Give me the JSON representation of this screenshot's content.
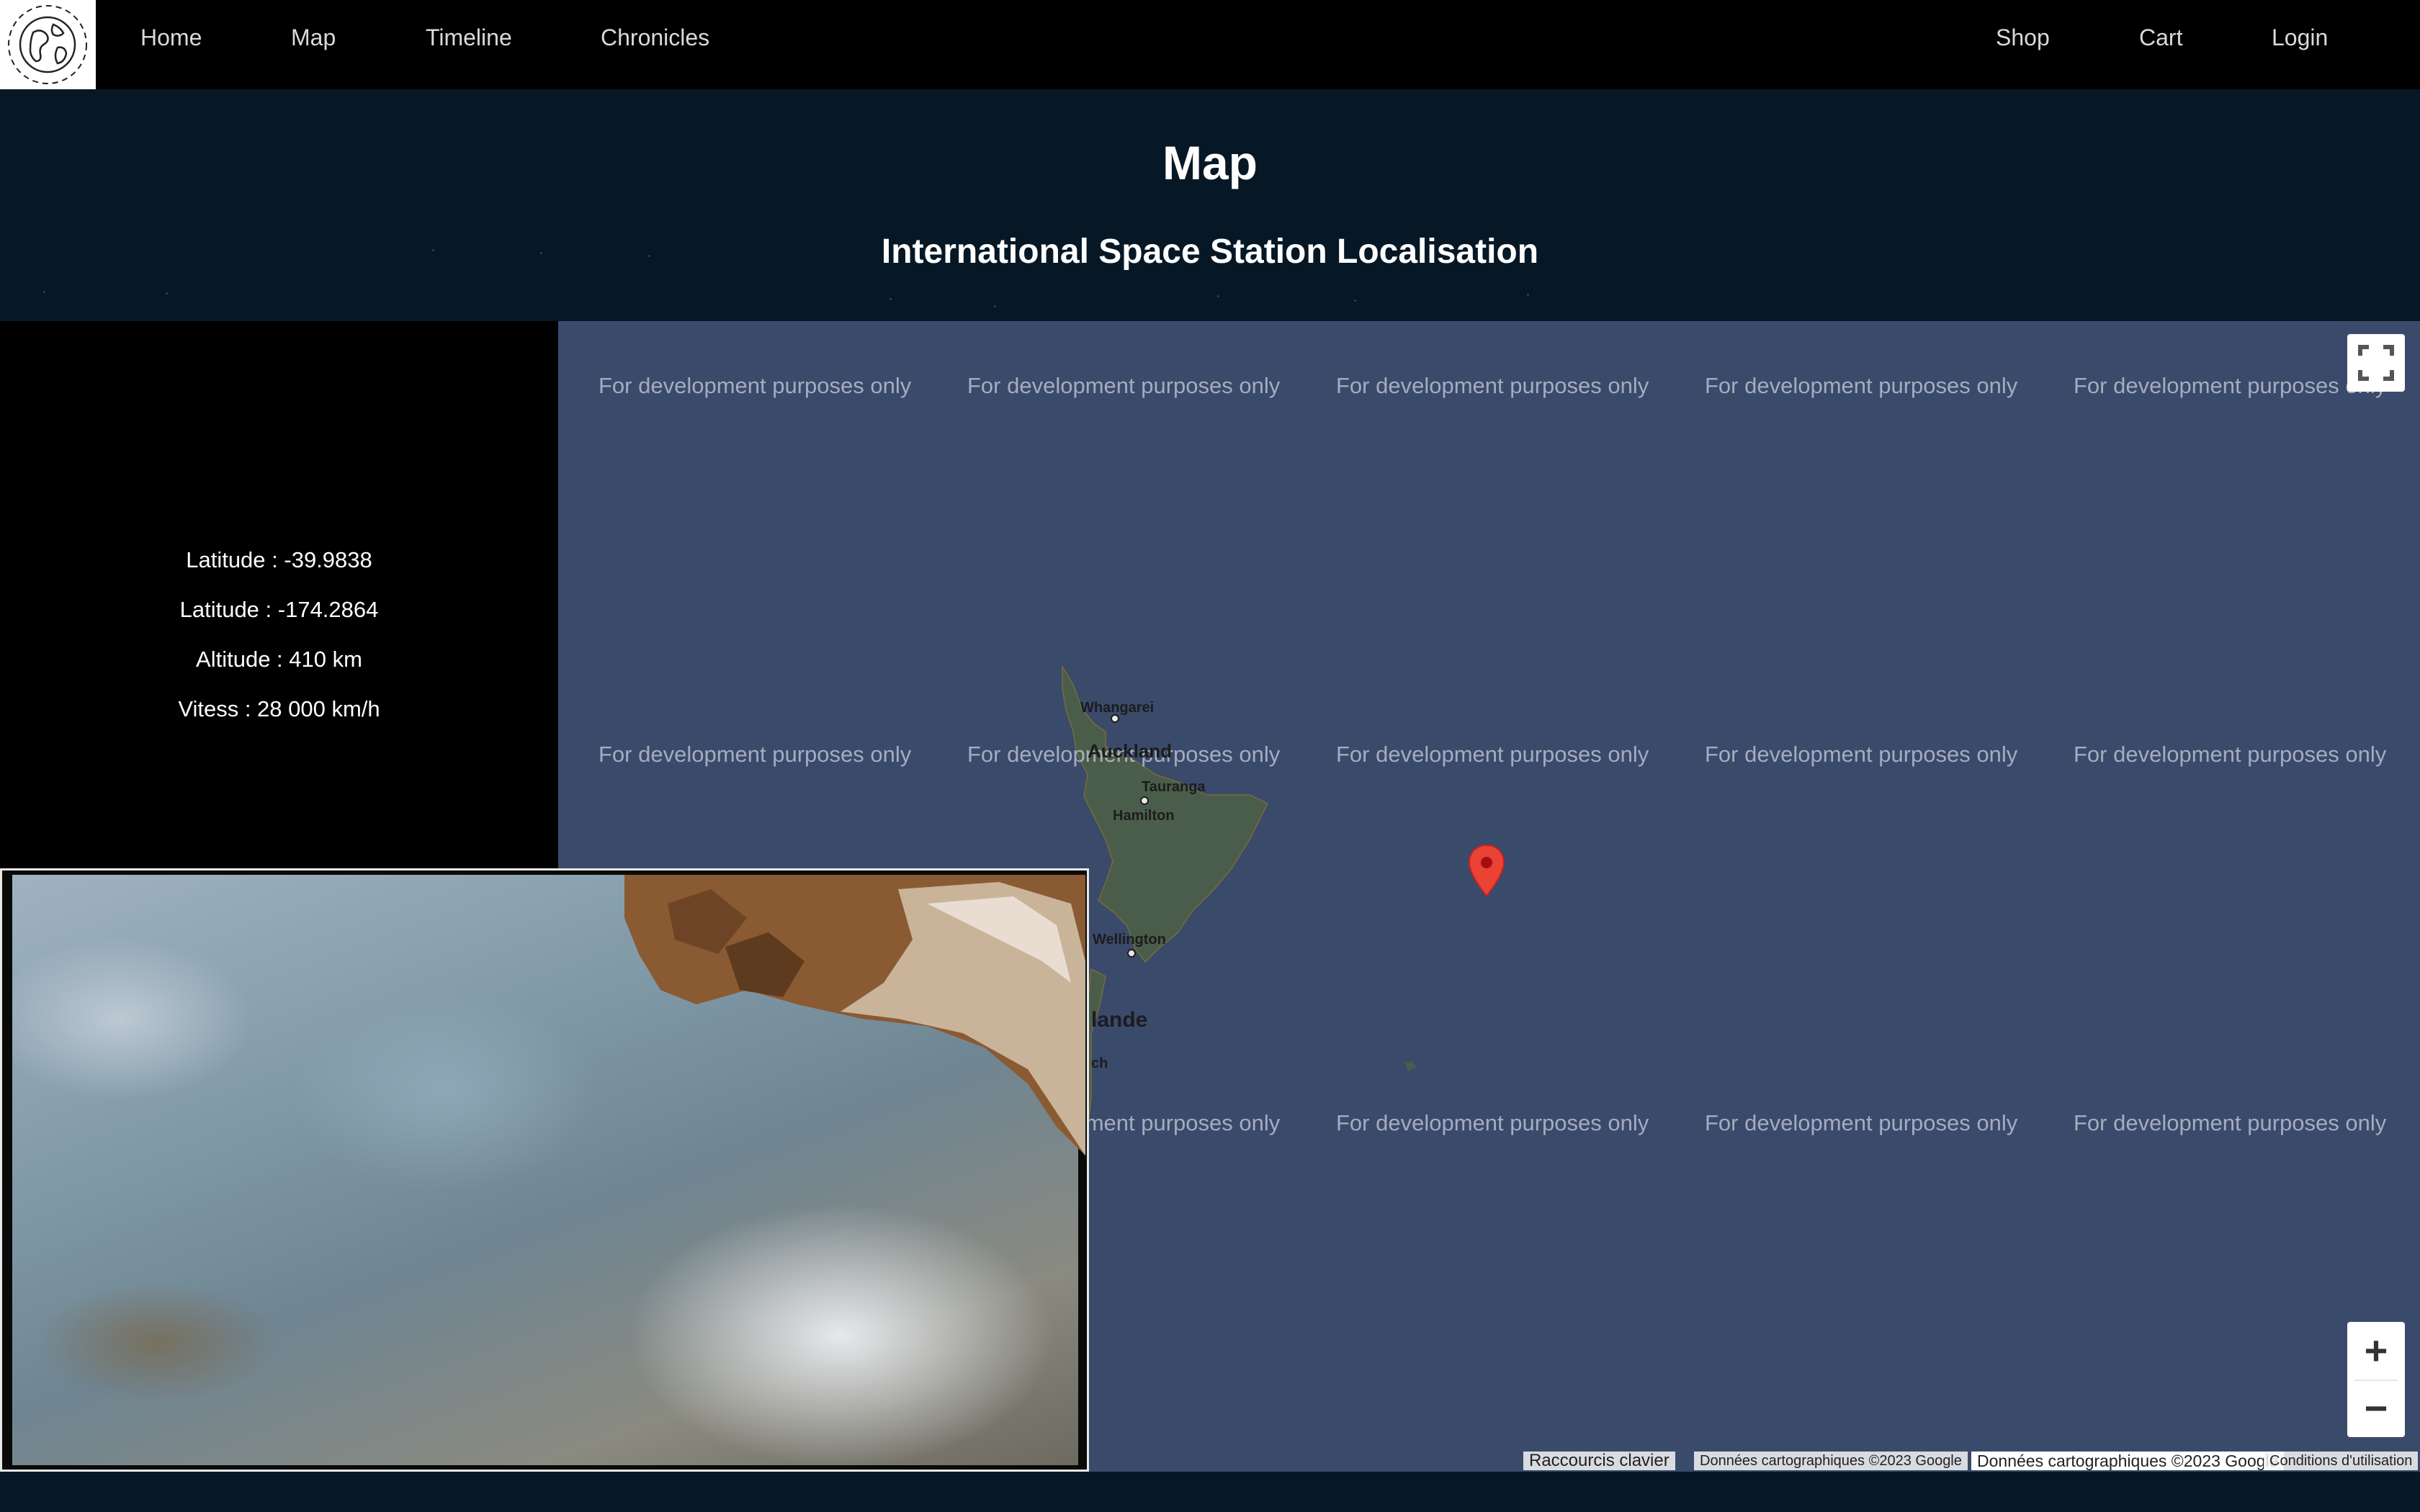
{
  "nav": {
    "logo_icon": "globe-icon",
    "left_links": [
      "Home",
      "Map",
      "Timeline",
      "Chronicles"
    ],
    "right_links": [
      "Shop",
      "Cart",
      "Login"
    ]
  },
  "hero": {
    "title": "Map",
    "subtitle": "International Space Station Localisation"
  },
  "iss_info": {
    "latitude": "Latitude : -39.9838",
    "longitude": "Latitude : -174.2864",
    "altitude": "Altitude : 410 km",
    "speed": "Vitess : 28 000 km/h"
  },
  "map": {
    "watermark": "For development purposes only",
    "cities": [
      "Whangarei",
      "Auckland",
      "Tauranga",
      "Hamilton",
      "Wellington"
    ],
    "country_label": "lande",
    "partial_city": "ch",
    "marker_icon": "map-pin-icon",
    "fullscreen_icon": "fullscreen-icon",
    "zoom_in": "+",
    "zoom_out": "−",
    "attribution": {
      "shortcuts": "Raccourcis clavier",
      "data1": "Données cartographiques ©2023 Google",
      "data2": "Données cartographiques ©2023 Google",
      "terms": "Conditions d'utilisation"
    },
    "colors": {
      "ocean": "#3a4a6b",
      "land": "#4a5d4a",
      "marker": "#ea4335"
    }
  },
  "video": {
    "description_icon": "iss-live-video"
  }
}
